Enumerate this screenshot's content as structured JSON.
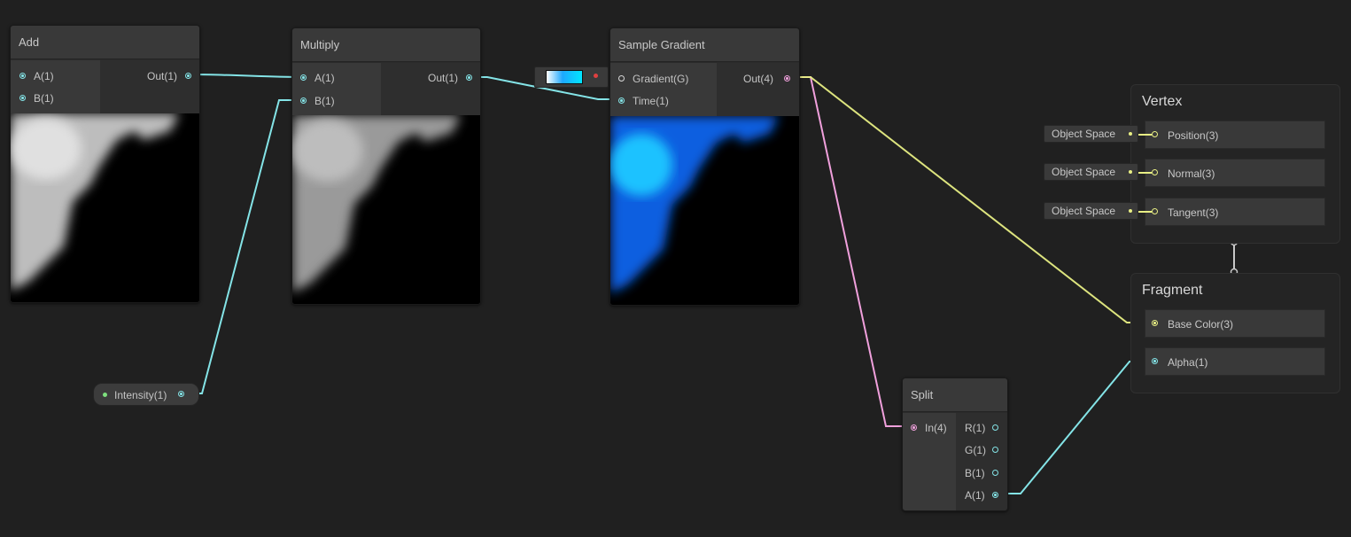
{
  "nodes": {
    "add": {
      "title": "Add",
      "in_a": "A(1)",
      "in_b": "B(1)",
      "out": "Out(1)"
    },
    "multiply": {
      "title": "Multiply",
      "in_a": "A(1)",
      "in_b": "B(1)",
      "out": "Out(1)"
    },
    "sample_gradient": {
      "title": "Sample Gradient",
      "in_gradient": "Gradient(G)",
      "in_time": "Time(1)",
      "out": "Out(4)"
    },
    "split": {
      "title": "Split",
      "in": "In(4)",
      "out_r": "R(1)",
      "out_g": "G(1)",
      "out_b": "B(1)",
      "out_a": "A(1)"
    },
    "intensity": {
      "label": "Intensity(1)"
    }
  },
  "master": {
    "vertex": {
      "title": "Vertex",
      "position": "Position(3)",
      "normal": "Normal(3)",
      "tangent": "Tangent(3)",
      "space_position": "Object Space",
      "space_normal": "Object Space",
      "space_tangent": "Object Space"
    },
    "fragment": {
      "title": "Fragment",
      "base_color": "Base Color(3)",
      "alpha": "Alpha(1)"
    }
  },
  "colors": {
    "background": "#202020",
    "float_wire": "#84e4e7",
    "vector4_wire": "#f0a0dc",
    "vector3_wire": "#e8ef84",
    "gradient_preview": "#1ea8ff"
  }
}
